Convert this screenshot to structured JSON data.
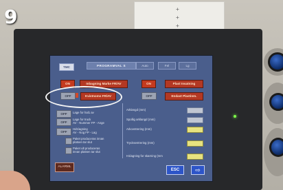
{
  "photo": {
    "frame_number": "9",
    "paper_marks": [
      "+",
      "+",
      "+"
    ]
  },
  "hmi": {
    "logo": "TMC",
    "title": "PROGRAMVAL S",
    "header_tabs": [
      "Auto",
      "Fel",
      "Lg"
    ],
    "top_buttons": {
      "on_left": "ON",
      "inbagning_label": "Inbagning Marke FR/AV",
      "on_right": "ON",
      "plast_label": "Plast Insatning"
    },
    "row2": {
      "off_left": "OFF",
      "kvistnoms_label": "Kvistnoms FR/AV",
      "off_right": "OFF",
      "endast_label": "Endast Plastinm."
    },
    "option_list": [
      {
        "state": "OFF",
        "text": "Lage for hal1 av"
      },
      {
        "state": "OFF",
        "text": "Lage for truck\nAV - Nummer FP - Ange"
      },
      {
        "state": "OFF",
        "text": "Hd1lagning\nAV - Nog FP - Lag"
      },
      {
        "state": "",
        "text": "Paket produceras innan\nplatsen tar slut"
      },
      {
        "state": "",
        "text": "Paket ult produceras\ninnan platsen tar slut"
      }
    ],
    "param_rows": [
      {
        "label": "Arklangd (mm)",
        "color": "grey"
      },
      {
        "label": "Spollig arklangd (mm)",
        "color": "grey"
      },
      {
        "label": "Arkcentrering (mm)",
        "color": "yellow"
      },
      {
        "label": "Trycksentrering (mm)",
        "color": "yellow"
      },
      {
        "label": "H1lagning for skarning (mm",
        "color": "yellow"
      }
    ],
    "alarm_label": "ALARML",
    "esc_label": "ESC",
    "next_arrow": "⇨"
  }
}
